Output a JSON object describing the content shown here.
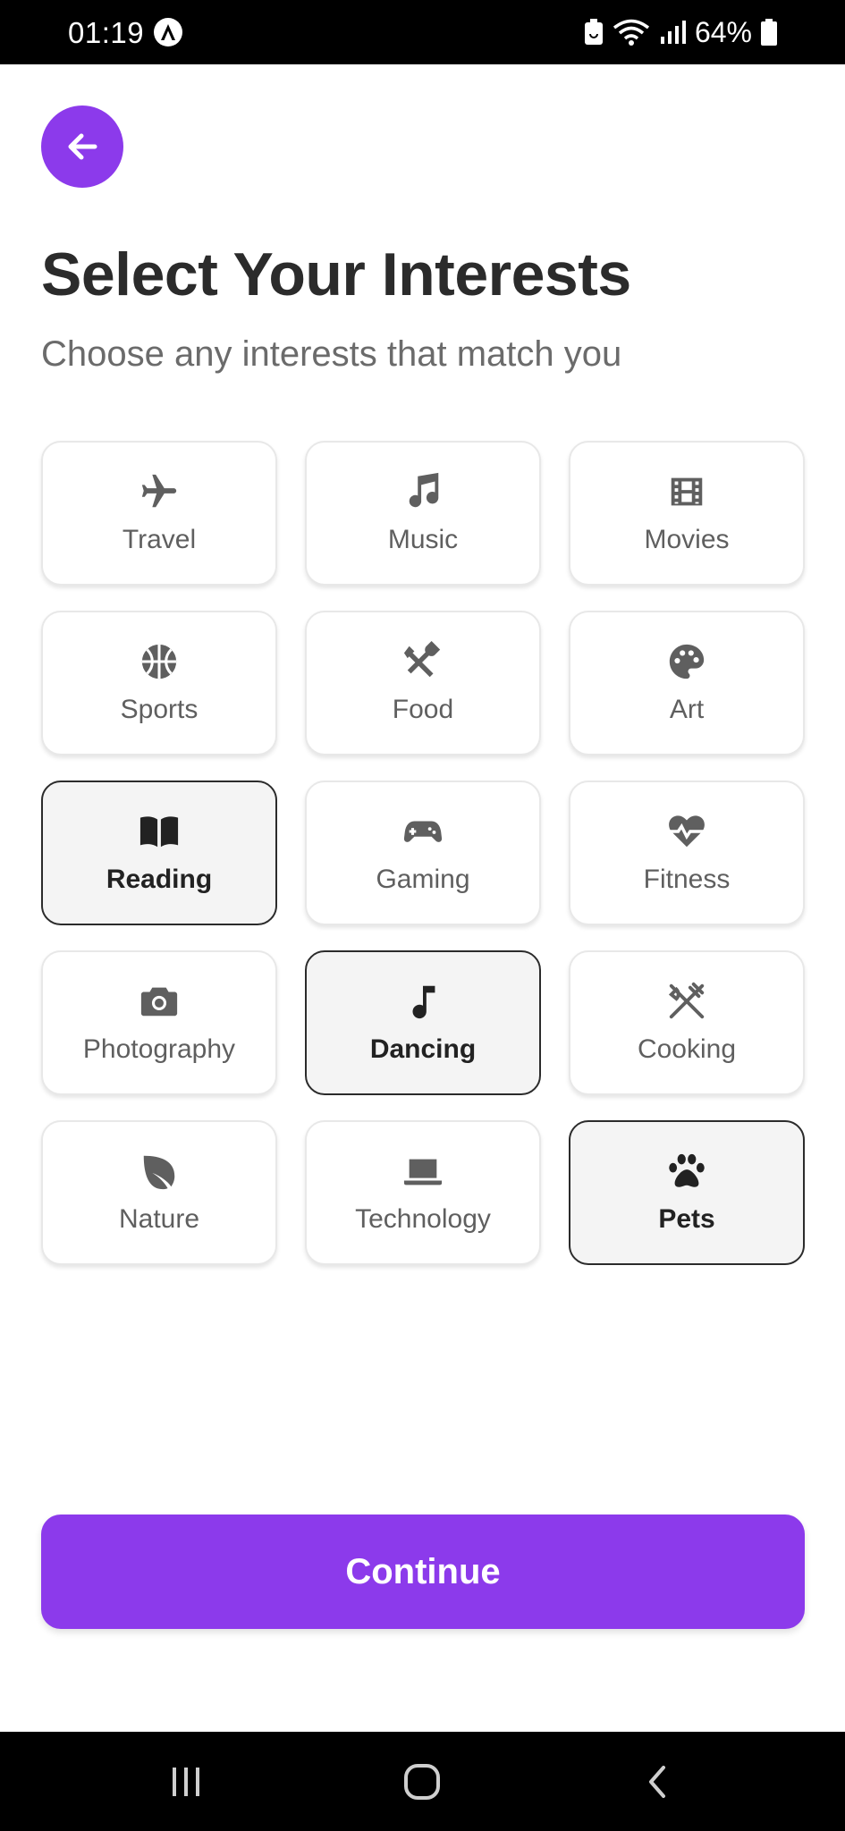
{
  "status_bar": {
    "time": "01:19",
    "battery_percent": "64%",
    "icons": [
      "a-circle-icon",
      "battery-saver-icon",
      "wifi-icon",
      "signal-icon",
      "battery-icon"
    ]
  },
  "header": {
    "back_icon": "arrow-left-icon",
    "title": "Select Your Interests",
    "subtitle": "Choose any interests that match you"
  },
  "interests": [
    {
      "label": "Travel",
      "icon": "plane-icon",
      "selected": false
    },
    {
      "label": "Music",
      "icon": "music-note-icon",
      "selected": false
    },
    {
      "label": "Movies",
      "icon": "film-icon",
      "selected": false
    },
    {
      "label": "Sports",
      "icon": "basketball-icon",
      "selected": false
    },
    {
      "label": "Food",
      "icon": "utensils-icon",
      "selected": false
    },
    {
      "label": "Art",
      "icon": "palette-icon",
      "selected": false
    },
    {
      "label": "Reading",
      "icon": "book-icon",
      "selected": true
    },
    {
      "label": "Gaming",
      "icon": "gamepad-icon",
      "selected": false
    },
    {
      "label": "Fitness",
      "icon": "heartbeat-icon",
      "selected": false
    },
    {
      "label": "Photography",
      "icon": "camera-icon",
      "selected": false
    },
    {
      "label": "Dancing",
      "icon": "single-note-icon",
      "selected": true
    },
    {
      "label": "Cooking",
      "icon": "fork-knife-icon",
      "selected": false
    },
    {
      "label": "Nature",
      "icon": "leaf-icon",
      "selected": false
    },
    {
      "label": "Technology",
      "icon": "laptop-icon",
      "selected": false
    },
    {
      "label": "Pets",
      "icon": "paw-icon",
      "selected": true
    }
  ],
  "continue_label": "Continue",
  "colors": {
    "accent": "#8c3aeb",
    "text_primary": "#2b2b2b",
    "text_secondary": "#6b6b6b",
    "selected_bg": "#f4f4f4"
  },
  "nav_bar": {
    "buttons": [
      "recent-apps-icon",
      "home-icon",
      "back-icon"
    ]
  }
}
